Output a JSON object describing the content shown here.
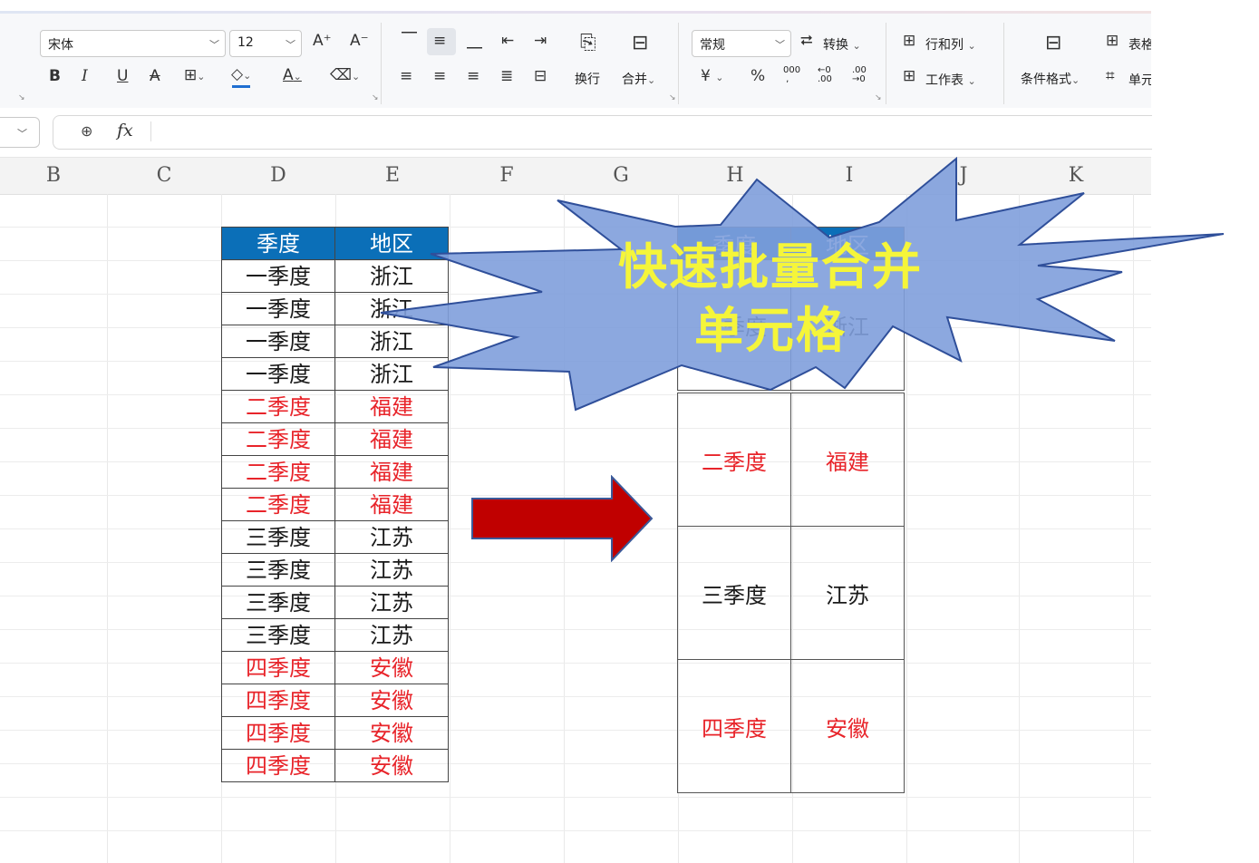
{
  "ribbon": {
    "font_name": "宋体",
    "font_size": "12",
    "bold": "B",
    "italic": "I",
    "underline": "U",
    "strike": "A",
    "grow_font": "A⁺",
    "shrink_font": "A⁻",
    "wrap_label": "换行",
    "merge_label": "合并",
    "number_format": "常规",
    "convert_label": "转换",
    "rows_cols_label": "行和列",
    "worksheet_label": "工作表",
    "currency": "¥",
    "percent": "%",
    "thousands": "000",
    "cond_format_label": "条件格式",
    "table_style_label": "表格",
    "cell_label": "单元"
  },
  "formula_bar": {
    "fx": "fx"
  },
  "columns": [
    "B",
    "C",
    "D",
    "E",
    "F",
    "G",
    "H",
    "I",
    "J",
    "K"
  ],
  "source_table": {
    "headers": [
      "季度",
      "地区"
    ],
    "rows": [
      {
        "q": "一季度",
        "r": "浙江",
        "tone": "black"
      },
      {
        "q": "一季度",
        "r": "浙江",
        "tone": "black"
      },
      {
        "q": "一季度",
        "r": "浙江",
        "tone": "black"
      },
      {
        "q": "一季度",
        "r": "浙江",
        "tone": "black"
      },
      {
        "q": "二季度",
        "r": "福建",
        "tone": "red"
      },
      {
        "q": "二季度",
        "r": "福建",
        "tone": "red"
      },
      {
        "q": "二季度",
        "r": "福建",
        "tone": "red"
      },
      {
        "q": "二季度",
        "r": "福建",
        "tone": "red"
      },
      {
        "q": "三季度",
        "r": "江苏",
        "tone": "black"
      },
      {
        "q": "三季度",
        "r": "江苏",
        "tone": "black"
      },
      {
        "q": "三季度",
        "r": "江苏",
        "tone": "black"
      },
      {
        "q": "三季度",
        "r": "江苏",
        "tone": "black"
      },
      {
        "q": "四季度",
        "r": "安徽",
        "tone": "red"
      },
      {
        "q": "四季度",
        "r": "安徽",
        "tone": "red"
      },
      {
        "q": "四季度",
        "r": "安徽",
        "tone": "red"
      },
      {
        "q": "四季度",
        "r": "安徽",
        "tone": "red"
      }
    ]
  },
  "merged_table": {
    "headers": [
      "季度",
      "地区"
    ],
    "groups": [
      {
        "q": "一季度",
        "r": "浙江",
        "tone": "black"
      },
      {
        "q": "二季度",
        "r": "福建",
        "tone": "red"
      },
      {
        "q": "三季度",
        "r": "江苏",
        "tone": "black"
      },
      {
        "q": "四季度",
        "r": "安徽",
        "tone": "red"
      }
    ]
  },
  "callout": {
    "line1": "快速批量合并",
    "line2": "单元格"
  },
  "colors": {
    "header_blue": "#0b6fb8",
    "red_text": "#e8242a",
    "arrow": "#c00000",
    "burst": "#7f9fdc",
    "callout_text": "#f5f53a"
  }
}
